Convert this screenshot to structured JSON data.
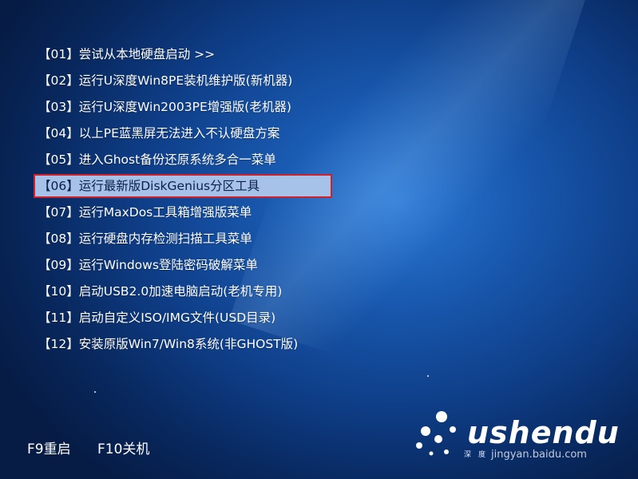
{
  "menu": {
    "items": [
      {
        "label": "【01】尝试从本地硬盘启动 >>"
      },
      {
        "label": "【02】运行U深度Win8PE装机维护版(新机器)"
      },
      {
        "label": "【03】运行U深度Win2003PE增强版(老机器)"
      },
      {
        "label": "【04】以上PE蓝黑屏无法进入不认硬盘方案"
      },
      {
        "label": "【05】进入Ghost备份还原系统多合一菜单"
      },
      {
        "label": "【06】运行最新版DiskGenius分区工具"
      },
      {
        "label": "【07】运行MaxDos工具箱增强版菜单"
      },
      {
        "label": "【08】运行硬盘内存检测扫描工具菜单"
      },
      {
        "label": "【09】运行Windows登陆密码破解菜单"
      },
      {
        "label": "【10】启动USB2.0加速电脑启动(老机专用)"
      },
      {
        "label": "【11】启动自定义ISO/IMG文件(USD目录)"
      },
      {
        "label": "【12】安装原版Win7/Win8系统(非GHOST版)"
      }
    ],
    "selected_index": 5
  },
  "footer": {
    "f9": "F9重启",
    "f10": "F10关机"
  },
  "logo": {
    "text": "ushendu",
    "sub": "深度",
    "watermark": "jingyan.baidu.com"
  },
  "colors": {
    "background": "#1857ad",
    "highlight_bg": "#a7c2e8",
    "highlight_border": "#d0202a",
    "text": "#ffffff"
  }
}
